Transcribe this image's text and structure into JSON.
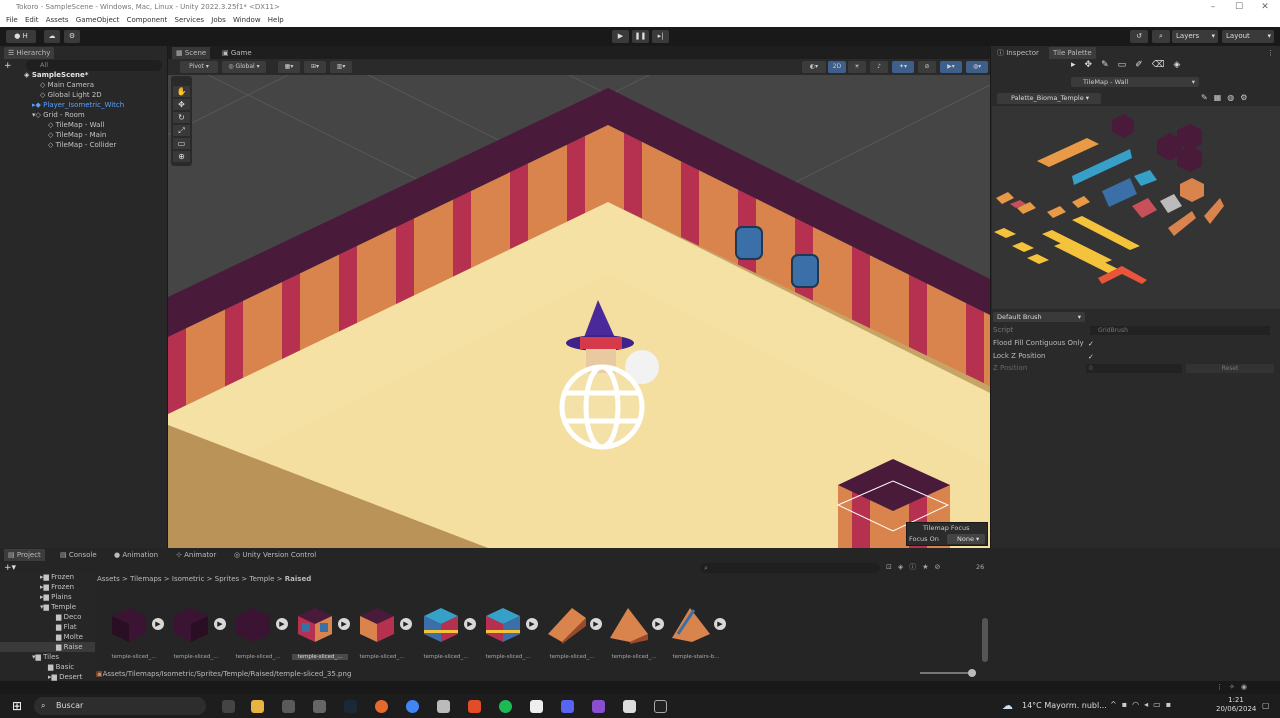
{
  "titlebar": {
    "title": "Tokoro - SampleScene - Windows, Mac, Linux - Unity 2022.3.25f1* <DX11>"
  },
  "menu": [
    "File",
    "Edit",
    "Assets",
    "GameObject",
    "Component",
    "Services",
    "Jobs",
    "Window",
    "Help"
  ],
  "toolbar": {
    "account": "H",
    "layers": "Layers",
    "layout": "Layout"
  },
  "hierarchy": {
    "tab": "Hierarchy",
    "search_placeholder": "All",
    "scene": "SampleScene*",
    "items": [
      "Main Camera",
      "Global Light 2D",
      "Player_Isometric_Witch",
      "Grid - Room",
      "TileMap - Wall",
      "TileMap - Main",
      "TileMap - Collider"
    ]
  },
  "view_tabs": {
    "scene": "Scene",
    "game": "Game"
  },
  "scene_toolbar": {
    "pivot": "Pivot",
    "global": "Global",
    "mode2d": "2D"
  },
  "overlay": {
    "title": "Tilemap Focus",
    "focus_label": "Focus On",
    "focus_value": "None"
  },
  "inspector": {
    "tab_inspector": "Inspector",
    "tab_palette": "Tile Palette",
    "active_tilemap": "TileMap - Wall",
    "palette_name": "Palette_Bioma_Temple",
    "brush": "Default Brush",
    "script_label": "Script",
    "script_value": "GridBrush",
    "flood_fill": "Flood Fill Contiguous Only",
    "lock_z": "Lock Z Position",
    "z_position_label": "Z Position",
    "z_position_value": "0",
    "reset": "Reset"
  },
  "bottom_tabs": [
    "Project",
    "Console",
    "Animation",
    "Animator",
    "Unity Version Control"
  ],
  "project": {
    "breadcrumb": [
      "Assets",
      "Tilemaps",
      "Isometric",
      "Sprites",
      "Temple",
      "Raised"
    ],
    "badge": "26",
    "folders": [
      "Frozen",
      "Frozen",
      "Plains",
      "Temple",
      "Deco",
      "Flat",
      "Molte",
      "Raise",
      "Tiles",
      "Basic",
      "Desert"
    ],
    "assets": [
      "temple-sliced_...",
      "temple-sliced_...",
      "temple-sliced_...",
      "temple-sliced_...",
      "temple-sliced_...",
      "temple-sliced_...",
      "temple-sliced_...",
      "temple-sliced_...",
      "temple-sliced_...",
      "temple-stairs-b..."
    ],
    "status_path": "Assets/Tilemaps/Isometric/Sprites/Temple/Raised/temple-sliced_35.png"
  },
  "taskbar": {
    "search": "Buscar",
    "weather_temp": "14°C",
    "weather_text": "Mayorm. nubl...",
    "time": "1:21",
    "date": "20/06/2024"
  },
  "colors": {
    "accent": "#3d80d6",
    "wall_dark": "#4a1a3a",
    "wall_stripe": "#b5314f",
    "wall_orange": "#d9834d",
    "floor": "#f5e1a4"
  }
}
